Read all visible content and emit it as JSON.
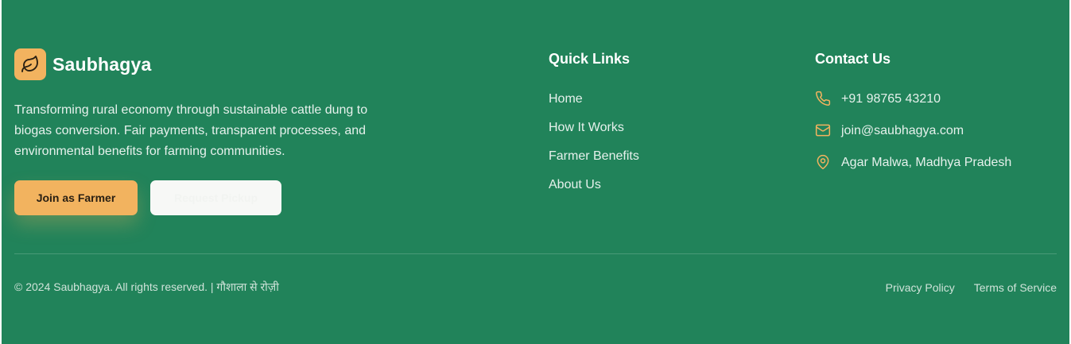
{
  "brand": {
    "name": "Saubhagya",
    "tagline": "Transforming rural economy through sustainable cattle dung to biogas conversion. Fair payments, transparent processes, and environmental benefits for farming communities.",
    "logo_icon": "leaf-icon"
  },
  "buttons": {
    "join_farmer": "Join as Farmer",
    "request_pickup": "Request Pickup"
  },
  "quick_links": {
    "title": "Quick Links",
    "items": [
      "Home",
      "How It Works",
      "Farmer Benefits",
      "About Us"
    ]
  },
  "contact": {
    "title": "Contact Us",
    "phone": "+91 98765 43210",
    "email": "join@saubhagya.com",
    "address": "Agar Malwa, Madhya Pradesh"
  },
  "bottom": {
    "copyright": "© 2024 Saubhagya. All rights reserved. | गौशाला से रोज़ी",
    "privacy": "Privacy Policy",
    "terms": "Terms of Service"
  },
  "colors": {
    "background": "#21835a",
    "accent": "#f2b35f"
  }
}
